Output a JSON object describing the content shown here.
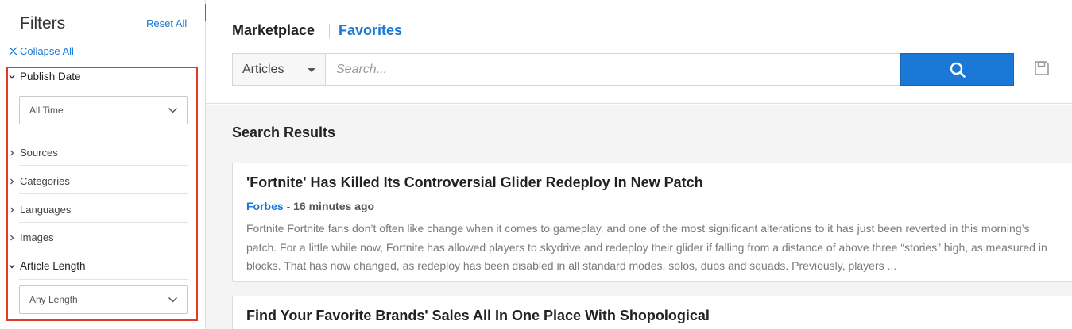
{
  "sidebar": {
    "title": "Filters",
    "reset_all": "Reset All",
    "collapse_all": "Collapse All",
    "facets": {
      "publish_date": {
        "label": "Publish Date",
        "expanded": true,
        "selected": "All Time"
      },
      "sources": {
        "label": "Sources",
        "expanded": false
      },
      "categories": {
        "label": "Categories",
        "expanded": false
      },
      "languages": {
        "label": "Languages",
        "expanded": false
      },
      "images": {
        "label": "Images",
        "expanded": false
      },
      "article_length": {
        "label": "Article Length",
        "expanded": true,
        "selected": "Any Length"
      }
    }
  },
  "header": {
    "tabs": {
      "marketplace": "Marketplace",
      "favorites": "Favorites"
    },
    "search": {
      "type_selected": "Articles",
      "placeholder": "Search...",
      "value": ""
    }
  },
  "results": {
    "title": "Search Results",
    "items": [
      {
        "title": "'Fortnite' Has Killed Its Controversial Glider Redeploy In New Patch",
        "source": "Forbes",
        "separator": " - ",
        "time": "16 minutes ago",
        "snippet": [
          "Fortnite Fortnite fans don’t often like change when it comes to gameplay, and one of the most significant alterations to it has just been reverted in this morning’s",
          "patch. For a little while now, Fortnite has allowed players to skydrive and redeploy their glider if falling from a distance of above three “stories” high, as measured in",
          "blocks. That has now changed, as redeploy has been disabled in all standard modes, solos, duos and squads. Previously, players ..."
        ]
      },
      {
        "title": "Find Your Favorite Brands' Sales All In One Place With Shopological"
      }
    ]
  },
  "colors": {
    "accent": "#1a78d6",
    "highlight_border": "#e13a25"
  }
}
